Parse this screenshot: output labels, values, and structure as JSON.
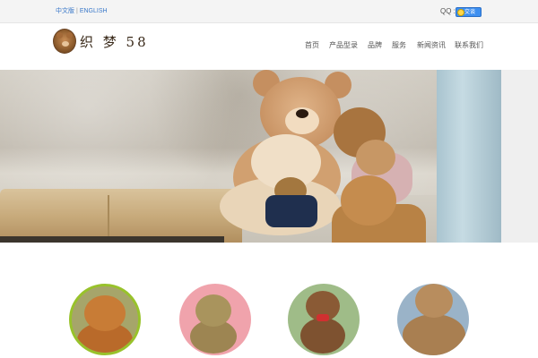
{
  "topbar": {
    "lang_cn": "中文版",
    "lang_sep": "|",
    "lang_en": "ENGLISH",
    "qq_label": "QQ :",
    "qq_button": "交谈"
  },
  "header": {
    "logo_text": "织 梦 58",
    "nav": [
      "首页",
      "产品型录",
      "品牌",
      "服务",
      "新闻资讯",
      "联系我们"
    ]
  },
  "banner": {
    "image": "teddy-bears-banner"
  },
  "products": [
    {
      "image": "product-bear-1",
      "ring_color": "#98c22b"
    },
    {
      "image": "product-bear-2",
      "bg_color": "#f0a3ac"
    },
    {
      "image": "product-bear-3",
      "bg_color": "#9fbc88"
    },
    {
      "image": "product-bear-4",
      "bg_color": "#9ab3c8"
    }
  ]
}
